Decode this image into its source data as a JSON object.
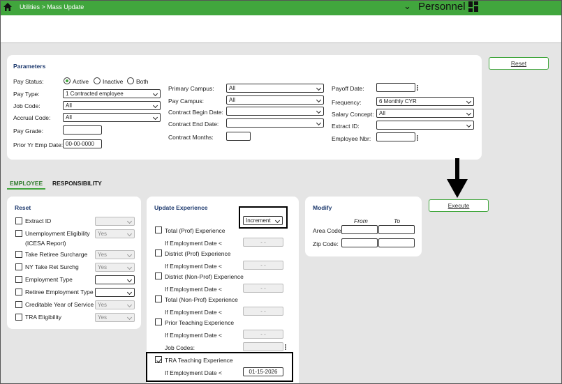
{
  "header": {
    "breadcrumb": "Utilities > Mass Update",
    "app_name": "Personnel"
  },
  "parameters": {
    "title": "Parameters",
    "pay_status_label": "Pay Status:",
    "pay_status_options": [
      "Active",
      "Inactive",
      "Both"
    ],
    "pay_status_selected": "Active",
    "pay_type_label": "Pay Type:",
    "pay_type_value": "1 Contracted employee",
    "job_code_label": "Job Code:",
    "job_code_value": "All",
    "accrual_code_label": "Accrual Code:",
    "accrual_code_value": "All",
    "pay_grade_label": "Pay Grade:",
    "prior_yr_emp_date_label": "Prior Yr Emp Date:",
    "prior_yr_emp_date_value": "00-00-0000",
    "primary_campus_label": "Primary Campus:",
    "primary_campus_value": "All",
    "pay_campus_label": "Pay Campus:",
    "pay_campus_value": "All",
    "contract_begin_date_label": "Contract Begin Date:",
    "contract_end_date_label": "Contract End Date:",
    "contract_months_label": "Contract Months:",
    "payoff_date_label": "Payoff Date:",
    "frequency_label": "Frequency:",
    "frequency_value": "6 Monthly CYR",
    "salary_concept_label": "Salary Concept:",
    "salary_concept_value": "All",
    "extract_id_label": "Extract ID:",
    "employee_nbr_label": "Employee Nbr:"
  },
  "buttons": {
    "reset": "Reset",
    "execute": "Execute"
  },
  "tabs": [
    {
      "label": "EMPLOYEE",
      "active": true
    },
    {
      "label": "RESPONSIBILITY",
      "active": false
    }
  ],
  "reset_panel": {
    "title": "Reset",
    "items": [
      {
        "label": "Extract ID",
        "value": ""
      },
      {
        "label": "Unemployment Eligibility",
        "label2": "(ICESA Report)",
        "value": "Yes"
      },
      {
        "label": "Take Retiree Surcharge",
        "value": "Yes"
      },
      {
        "label": "NY Take Ret Surchg",
        "value": "Yes"
      },
      {
        "label": "Employment Type",
        "value": ""
      },
      {
        "label": "Retiree Employment Type",
        "value": ""
      },
      {
        "label": "Creditable Year of Service",
        "value": "Yes"
      },
      {
        "label": "TRA Eligibility",
        "value": "Yes"
      }
    ]
  },
  "update_experience": {
    "title": "Update Experience",
    "mode_value": "Increment",
    "date_label": "If Employment Date <",
    "empty_date": "- -",
    "job_codes_label": "Job Codes:",
    "items": [
      {
        "label": "Total (Prof) Experience",
        "checked": false
      },
      {
        "label": "District (Prof) Experience",
        "checked": false
      },
      {
        "label": "District (Non-Prof) Experience",
        "checked": false
      },
      {
        "label": "Total (Non-Prof) Experience",
        "checked": false
      },
      {
        "label": "Prior Teaching Experience",
        "checked": false
      }
    ],
    "tra": {
      "label": "TRA Teaching Experience",
      "checked": true,
      "date": "01-15-2026"
    }
  },
  "modify": {
    "title": "Modify",
    "from_label": "From",
    "to_label": "To",
    "area_code_label": "Area Code:",
    "zip_code_label": "Zip Code:"
  }
}
